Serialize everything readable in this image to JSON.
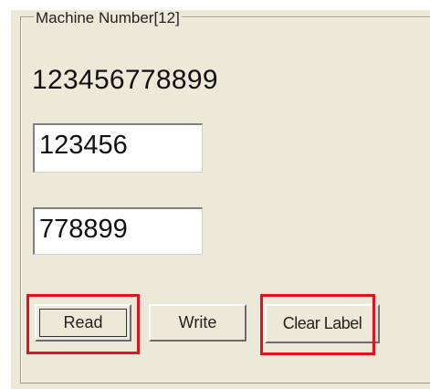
{
  "group": {
    "title": "Machine Number[12]"
  },
  "serial_label": "123456778899",
  "fields": [
    {
      "value": "123456"
    },
    {
      "value": "778899"
    }
  ],
  "buttons": {
    "read": "Read",
    "write": "Write",
    "clear_label": "Clear Label"
  },
  "highlight_color": "#e0141e"
}
